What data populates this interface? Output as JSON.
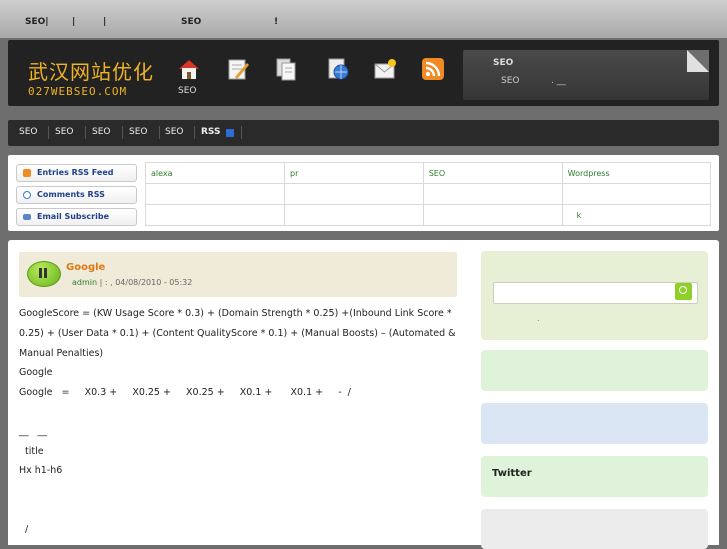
{
  "topbar": {
    "item1": "SEO|",
    "item2": "|",
    "item3": "|",
    "item4": "SEO",
    "item5": "!"
  },
  "header": {
    "logo_cn": "武汉网站优化",
    "logo_en": "027WEBSEO.COM",
    "icons": [
      "home-icon",
      "edit-icon",
      "pages-icon",
      "globe-icon",
      "mail-icon",
      "rss-icon"
    ],
    "home_label": "SEO",
    "box_title": "SEO",
    "box_line1": "SEO",
    "box_line2": ". __"
  },
  "nav": {
    "items": [
      "SEO",
      "SEO",
      "SEO",
      "SEO",
      "SEO"
    ],
    "rss_label": "RSS"
  },
  "feeds": {
    "entries_rss": "Entries RSS Feed",
    "comments_rss": "Comments RSS",
    "email_subscribe": "Email Subscribe",
    "table": [
      [
        "alexa",
        "pr",
        "SEO",
        "Wordpress"
      ],
      [
        "",
        "",
        "",
        ""
      ],
      [
        "",
        "",
        "",
        "k"
      ]
    ]
  },
  "post": {
    "title": "Google",
    "author": "admin",
    "meta_sep": "|   :",
    "date": ", 04/08/2010 - 05:32",
    "lines": [
      "GoogleScore = (KW Usage Score * 0.3) + (Domain Strength * 0.25) +(Inbound Link Score *",
      "0.25) + (User Data * 0.1) + (Content QualityScore * 0.1) + (Manual Boosts) – (Automated &",
      "Manual Penalties)",
      "Google",
      "Google   =     X0.3 +     X0.25 +     X0.25 +     X0.1 +      X0.1 +     -  /",
      "",
      "__   __",
      "  title",
      "Hx h1-h6",
      "",
      "",
      "  /"
    ]
  },
  "sidebar": {
    "search_value": "",
    "search_note": ".",
    "twitter_title": "Twitter"
  },
  "colors": {
    "accent": "#f0b323",
    "title": "#e07a17",
    "link": "#2d7d2d"
  }
}
